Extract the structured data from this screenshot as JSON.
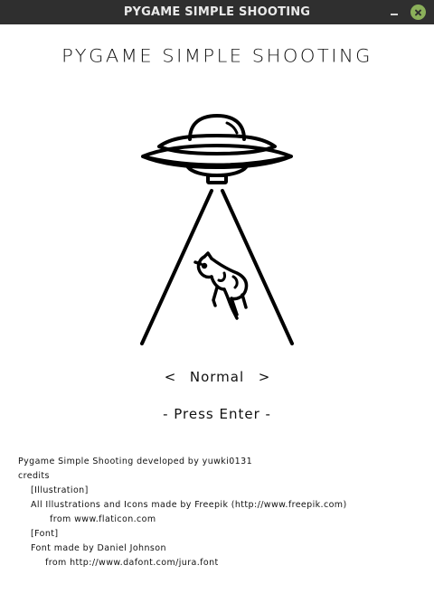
{
  "window": {
    "title": "PYGAME SIMPLE SHOOTING"
  },
  "screen": {
    "title": "PYGAME SIMPLE SHOOTING",
    "illustration_icon": "ufo-abducting-cow-icon",
    "difficulty": {
      "left_arrow": "<",
      "value": "Normal",
      "right_arrow": ">"
    },
    "prompt": "- Press Enter -"
  },
  "credits": {
    "line1": "Pygame Simple Shooting developed by yuwki0131",
    "line2": "credits",
    "line3": "[Illustration]",
    "line4": "All Illustrations and Icons made by Freepik (http://www.freepik.com)",
    "line5": "from www.flaticon.com",
    "line6": "[Font]",
    "line7": "Font made by Daniel Johnson",
    "line8": "from http://www.dafont.com/jura.font"
  }
}
